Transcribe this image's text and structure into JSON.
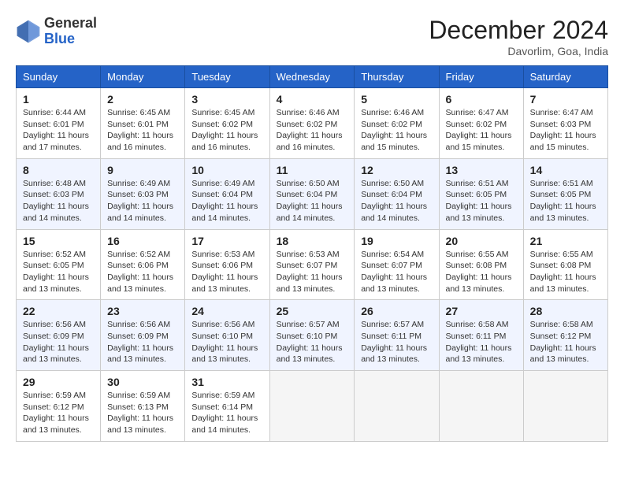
{
  "header": {
    "logo": {
      "text_general": "General",
      "text_blue": "Blue"
    },
    "title": "December 2024",
    "subtitle": "Davorlim, Goa, India"
  },
  "calendar": {
    "days_of_week": [
      "Sunday",
      "Monday",
      "Tuesday",
      "Wednesday",
      "Thursday",
      "Friday",
      "Saturday"
    ],
    "weeks": [
      [
        {
          "day": "1",
          "sunrise": "Sunrise: 6:44 AM",
          "sunset": "Sunset: 6:01 PM",
          "daylight": "Daylight: 11 hours and 17 minutes."
        },
        {
          "day": "2",
          "sunrise": "Sunrise: 6:45 AM",
          "sunset": "Sunset: 6:01 PM",
          "daylight": "Daylight: 11 hours and 16 minutes."
        },
        {
          "day": "3",
          "sunrise": "Sunrise: 6:45 AM",
          "sunset": "Sunset: 6:02 PM",
          "daylight": "Daylight: 11 hours and 16 minutes."
        },
        {
          "day": "4",
          "sunrise": "Sunrise: 6:46 AM",
          "sunset": "Sunset: 6:02 PM",
          "daylight": "Daylight: 11 hours and 16 minutes."
        },
        {
          "day": "5",
          "sunrise": "Sunrise: 6:46 AM",
          "sunset": "Sunset: 6:02 PM",
          "daylight": "Daylight: 11 hours and 15 minutes."
        },
        {
          "day": "6",
          "sunrise": "Sunrise: 6:47 AM",
          "sunset": "Sunset: 6:02 PM",
          "daylight": "Daylight: 11 hours and 15 minutes."
        },
        {
          "day": "7",
          "sunrise": "Sunrise: 6:47 AM",
          "sunset": "Sunset: 6:03 PM",
          "daylight": "Daylight: 11 hours and 15 minutes."
        }
      ],
      [
        {
          "day": "8",
          "sunrise": "Sunrise: 6:48 AM",
          "sunset": "Sunset: 6:03 PM",
          "daylight": "Daylight: 11 hours and 14 minutes."
        },
        {
          "day": "9",
          "sunrise": "Sunrise: 6:49 AM",
          "sunset": "Sunset: 6:03 PM",
          "daylight": "Daylight: 11 hours and 14 minutes."
        },
        {
          "day": "10",
          "sunrise": "Sunrise: 6:49 AM",
          "sunset": "Sunset: 6:04 PM",
          "daylight": "Daylight: 11 hours and 14 minutes."
        },
        {
          "day": "11",
          "sunrise": "Sunrise: 6:50 AM",
          "sunset": "Sunset: 6:04 PM",
          "daylight": "Daylight: 11 hours and 14 minutes."
        },
        {
          "day": "12",
          "sunrise": "Sunrise: 6:50 AM",
          "sunset": "Sunset: 6:04 PM",
          "daylight": "Daylight: 11 hours and 14 minutes."
        },
        {
          "day": "13",
          "sunrise": "Sunrise: 6:51 AM",
          "sunset": "Sunset: 6:05 PM",
          "daylight": "Daylight: 11 hours and 13 minutes."
        },
        {
          "day": "14",
          "sunrise": "Sunrise: 6:51 AM",
          "sunset": "Sunset: 6:05 PM",
          "daylight": "Daylight: 11 hours and 13 minutes."
        }
      ],
      [
        {
          "day": "15",
          "sunrise": "Sunrise: 6:52 AM",
          "sunset": "Sunset: 6:05 PM",
          "daylight": "Daylight: 11 hours and 13 minutes."
        },
        {
          "day": "16",
          "sunrise": "Sunrise: 6:52 AM",
          "sunset": "Sunset: 6:06 PM",
          "daylight": "Daylight: 11 hours and 13 minutes."
        },
        {
          "day": "17",
          "sunrise": "Sunrise: 6:53 AM",
          "sunset": "Sunset: 6:06 PM",
          "daylight": "Daylight: 11 hours and 13 minutes."
        },
        {
          "day": "18",
          "sunrise": "Sunrise: 6:53 AM",
          "sunset": "Sunset: 6:07 PM",
          "daylight": "Daylight: 11 hours and 13 minutes."
        },
        {
          "day": "19",
          "sunrise": "Sunrise: 6:54 AM",
          "sunset": "Sunset: 6:07 PM",
          "daylight": "Daylight: 11 hours and 13 minutes."
        },
        {
          "day": "20",
          "sunrise": "Sunrise: 6:55 AM",
          "sunset": "Sunset: 6:08 PM",
          "daylight": "Daylight: 11 hours and 13 minutes."
        },
        {
          "day": "21",
          "sunrise": "Sunrise: 6:55 AM",
          "sunset": "Sunset: 6:08 PM",
          "daylight": "Daylight: 11 hours and 13 minutes."
        }
      ],
      [
        {
          "day": "22",
          "sunrise": "Sunrise: 6:56 AM",
          "sunset": "Sunset: 6:09 PM",
          "daylight": "Daylight: 11 hours and 13 minutes."
        },
        {
          "day": "23",
          "sunrise": "Sunrise: 6:56 AM",
          "sunset": "Sunset: 6:09 PM",
          "daylight": "Daylight: 11 hours and 13 minutes."
        },
        {
          "day": "24",
          "sunrise": "Sunrise: 6:56 AM",
          "sunset": "Sunset: 6:10 PM",
          "daylight": "Daylight: 11 hours and 13 minutes."
        },
        {
          "day": "25",
          "sunrise": "Sunrise: 6:57 AM",
          "sunset": "Sunset: 6:10 PM",
          "daylight": "Daylight: 11 hours and 13 minutes."
        },
        {
          "day": "26",
          "sunrise": "Sunrise: 6:57 AM",
          "sunset": "Sunset: 6:11 PM",
          "daylight": "Daylight: 11 hours and 13 minutes."
        },
        {
          "day": "27",
          "sunrise": "Sunrise: 6:58 AM",
          "sunset": "Sunset: 6:11 PM",
          "daylight": "Daylight: 11 hours and 13 minutes."
        },
        {
          "day": "28",
          "sunrise": "Sunrise: 6:58 AM",
          "sunset": "Sunset: 6:12 PM",
          "daylight": "Daylight: 11 hours and 13 minutes."
        }
      ],
      [
        {
          "day": "29",
          "sunrise": "Sunrise: 6:59 AM",
          "sunset": "Sunset: 6:12 PM",
          "daylight": "Daylight: 11 hours and 13 minutes."
        },
        {
          "day": "30",
          "sunrise": "Sunrise: 6:59 AM",
          "sunset": "Sunset: 6:13 PM",
          "daylight": "Daylight: 11 hours and 13 minutes."
        },
        {
          "day": "31",
          "sunrise": "Sunrise: 6:59 AM",
          "sunset": "Sunset: 6:14 PM",
          "daylight": "Daylight: 11 hours and 14 minutes."
        },
        null,
        null,
        null,
        null
      ]
    ]
  }
}
